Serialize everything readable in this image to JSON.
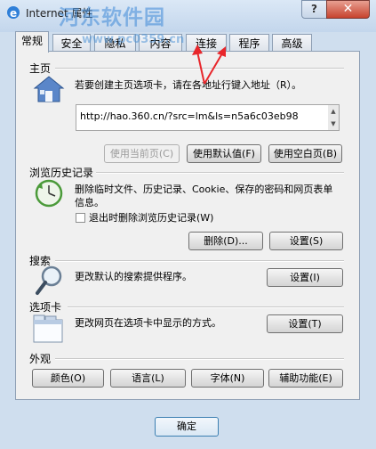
{
  "window": {
    "title": "Internet 属性",
    "help_label": "?",
    "close_label": "✕",
    "watermark_text": "河东软件园",
    "watermark_url": "www.pc0359.cn"
  },
  "tabs": [
    {
      "label": "常规",
      "active": true
    },
    {
      "label": "安全",
      "active": false
    },
    {
      "label": "隐私",
      "active": false
    },
    {
      "label": "内容",
      "active": false
    },
    {
      "label": "连接",
      "active": false
    },
    {
      "label": "程序",
      "active": false
    },
    {
      "label": "高级",
      "active": false
    }
  ],
  "home": {
    "section_label": "主页",
    "description": "若要创建主页选项卡，请在各地址行键入地址（R）。",
    "address_value": "http://hao.360.cn/?src=lm&ls=n5a6c03eb98",
    "use_current_label": "使用当前页(C)",
    "use_default_label": "使用默认值(F)",
    "use_blank_label": "使用空白页(B)"
  },
  "history": {
    "section_label": "浏览历史记录",
    "description": "删除临时文件、历史记录、Cookie、保存的密码和网页表单信息。",
    "checkbox_label": "退出时删除浏览历史记录(W)",
    "checkbox_checked": false,
    "delete_label": "删除(D)...",
    "settings_label": "设置(S)"
  },
  "search": {
    "section_label": "搜索",
    "description": "更改默认的搜索提供程序。",
    "settings_label": "设置(I)"
  },
  "tabs_section": {
    "section_label": "选项卡",
    "description": "更改网页在选项卡中显示的方式。",
    "settings_label": "设置(T)"
  },
  "appearance": {
    "section_label": "外观",
    "colors_label": "颜色(O)",
    "languages_label": "语言(L)",
    "fonts_label": "字体(N)",
    "accessibility_label": "辅助功能(E)"
  },
  "footer": {
    "ok_label": "确定"
  },
  "colors": {
    "annotation_arrow": "#e8262b",
    "title_bar": "#c3d6ec",
    "close_button": "#c7432e"
  }
}
